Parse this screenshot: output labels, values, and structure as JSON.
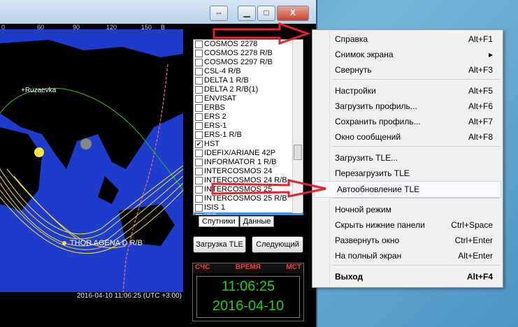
{
  "map": {
    "ticks": [
      "0",
      "60",
      "90",
      "120",
      "150",
      "B"
    ],
    "labels": {
      "city": "+Ruzaevka",
      "sat": "THOR AGENA D R/B"
    },
    "statusbar": "2016-04-10 11:06:25 (UTC +3:00)"
  },
  "window": {
    "restore_icon": "⇔",
    "min_icon": "▁",
    "max_icon": "□",
    "close_icon": "X"
  },
  "satellites": [
    {
      "name": "COSMOS 2278",
      "checked": false
    },
    {
      "name": "COSMOS 2278 R/B",
      "checked": false
    },
    {
      "name": "COSMOS 2297 R/B",
      "checked": false
    },
    {
      "name": "CSL-4 R/B",
      "checked": false
    },
    {
      "name": "DELTA 1 R/B",
      "checked": false
    },
    {
      "name": "DELTA 2 R/B(1)",
      "checked": false
    },
    {
      "name": "ENVISAT",
      "checked": false
    },
    {
      "name": "ERBS",
      "checked": false
    },
    {
      "name": "ERS 2",
      "checked": false
    },
    {
      "name": "ERS-1",
      "checked": false
    },
    {
      "name": "ERS-1 R/B",
      "checked": false
    },
    {
      "name": "HST",
      "checked": true
    },
    {
      "name": "IDEFIX/ARIANE 42P",
      "checked": false
    },
    {
      "name": "INFORMATOR 1 R/B",
      "checked": false
    },
    {
      "name": "INTERCOSMOS 24",
      "checked": false
    },
    {
      "name": "INTERCOSMOS 24 R/B",
      "checked": false
    },
    {
      "name": "INTERCOSMOS 25",
      "checked": false
    },
    {
      "name": "INTERCOSMOS 25 R/B",
      "checked": false
    },
    {
      "name": "ISIS 1",
      "checked": false
    },
    {
      "name": "ISS",
      "checked": true,
      "selected": true
    }
  ],
  "tabs": {
    "satellites": "Спутники",
    "data": "Данные"
  },
  "buttons": {
    "load_tle": "Загрузка TLE",
    "next": "Следующий"
  },
  "clock": {
    "col1": "CЧC",
    "col2": "ВРЕМЯ",
    "col3": "MCT",
    "time": "11:06:25",
    "date": "2016-04-10"
  },
  "menu": {
    "items": [
      {
        "label": "Справка",
        "shortcut": "Alt+F1"
      },
      {
        "label": "Снимок экрана",
        "shortcut": "▸"
      },
      {
        "label": "Свернуть",
        "shortcut": "Alt+F3"
      },
      {
        "label": "Настройки",
        "shortcut": "Alt+F5"
      },
      {
        "label": "Загрузить профиль...",
        "shortcut": "Alt+F6"
      },
      {
        "label": "Сохранить профиль...",
        "shortcut": "Alt+F7"
      },
      {
        "label": "Окно сообщений",
        "shortcut": "Alt+F8"
      },
      {
        "label": "Загрузить TLE...",
        "shortcut": ""
      },
      {
        "label": "Перезагрузить TLE",
        "shortcut": ""
      },
      {
        "label": "Автообновление TLE",
        "shortcut": ""
      },
      {
        "label": "Ночной режим",
        "shortcut": ""
      },
      {
        "label": "Скрыть нижние панели",
        "shortcut": "Ctrl+Space"
      },
      {
        "label": "Развернуть окно",
        "shortcut": "Ctrl+Enter"
      },
      {
        "label": "На полный экран",
        "shortcut": "Alt+Enter"
      },
      {
        "label": "Выход",
        "shortcut": "Alt+F4"
      }
    ]
  },
  "colors": {
    "arrow": "#e8212a",
    "map_ocean": "#1e3ccc",
    "clock_green": "#1ed11e",
    "clock_red": "#ff3b3b"
  }
}
